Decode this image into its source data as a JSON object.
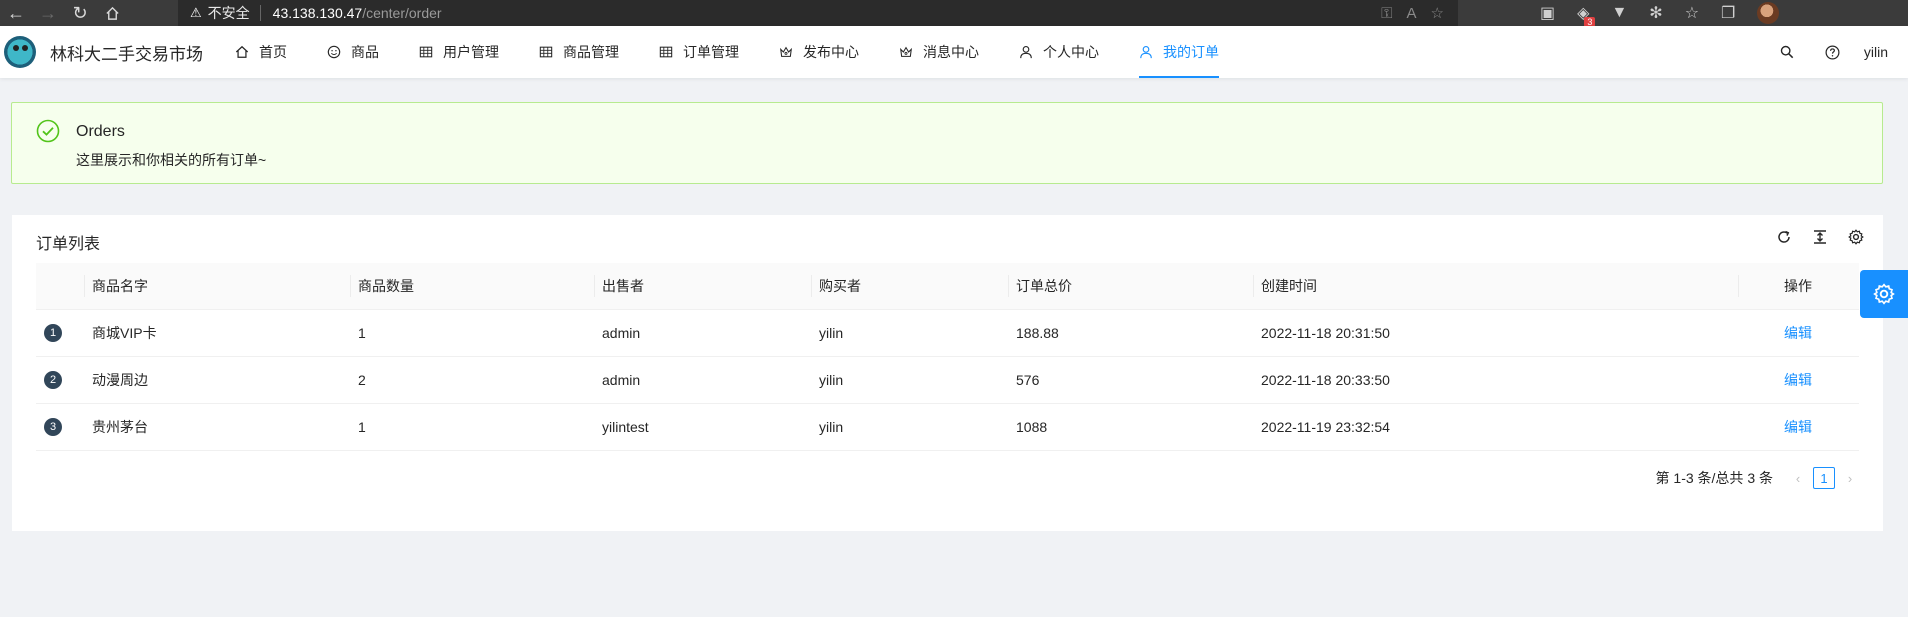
{
  "browser": {
    "url_warning": "不安全",
    "url_host": "43.138.130.47",
    "url_path": "/center/order",
    "extension_badge": "3"
  },
  "header": {
    "app_title": "林科大二手交易市场",
    "menu": [
      {
        "label": "首页",
        "icon": "home-icon"
      },
      {
        "label": "商品",
        "icon": "smile-icon"
      },
      {
        "label": "用户管理",
        "icon": "table-icon"
      },
      {
        "label": "商品管理",
        "icon": "table-icon"
      },
      {
        "label": "订单管理",
        "icon": "table-icon"
      },
      {
        "label": "发布中心",
        "icon": "crown-icon"
      },
      {
        "label": "消息中心",
        "icon": "crown-icon"
      },
      {
        "label": "个人中心",
        "icon": "user-icon"
      },
      {
        "label": "我的订单",
        "icon": "user-icon",
        "active": true
      }
    ],
    "username": "yilin"
  },
  "alert": {
    "title": "Orders",
    "description": "这里展示和你相关的所有订单~"
  },
  "card": {
    "title": "订单列表"
  },
  "table": {
    "columns": [
      "",
      "商品名字",
      "商品数量",
      "出售者",
      "购买者",
      "订单总价",
      "创建时间",
      "操作"
    ],
    "rows": [
      {
        "index": "1",
        "name": "商城VIP卡",
        "quantity": "1",
        "seller": "admin",
        "buyer": "yilin",
        "total": "188.88",
        "created": "2022-11-18 20:31:50",
        "action": "编辑"
      },
      {
        "index": "2",
        "name": "动漫周边",
        "quantity": "2",
        "seller": "admin",
        "buyer": "yilin",
        "total": "576",
        "created": "2022-11-18 20:33:50",
        "action": "编辑"
      },
      {
        "index": "3",
        "name": "贵州茅台",
        "quantity": "1",
        "seller": "yilintest",
        "buyer": "yilin",
        "total": "1088",
        "created": "2022-11-19 23:32:54",
        "action": "编辑"
      }
    ]
  },
  "pagination": {
    "total_text": "第 1-3 条/总共 3 条",
    "current_page": "1"
  },
  "colors": {
    "primary": "#1890ff",
    "success_bg": "#f6ffed",
    "success_border": "#b7eb8f",
    "success_icon": "#52c41a"
  }
}
